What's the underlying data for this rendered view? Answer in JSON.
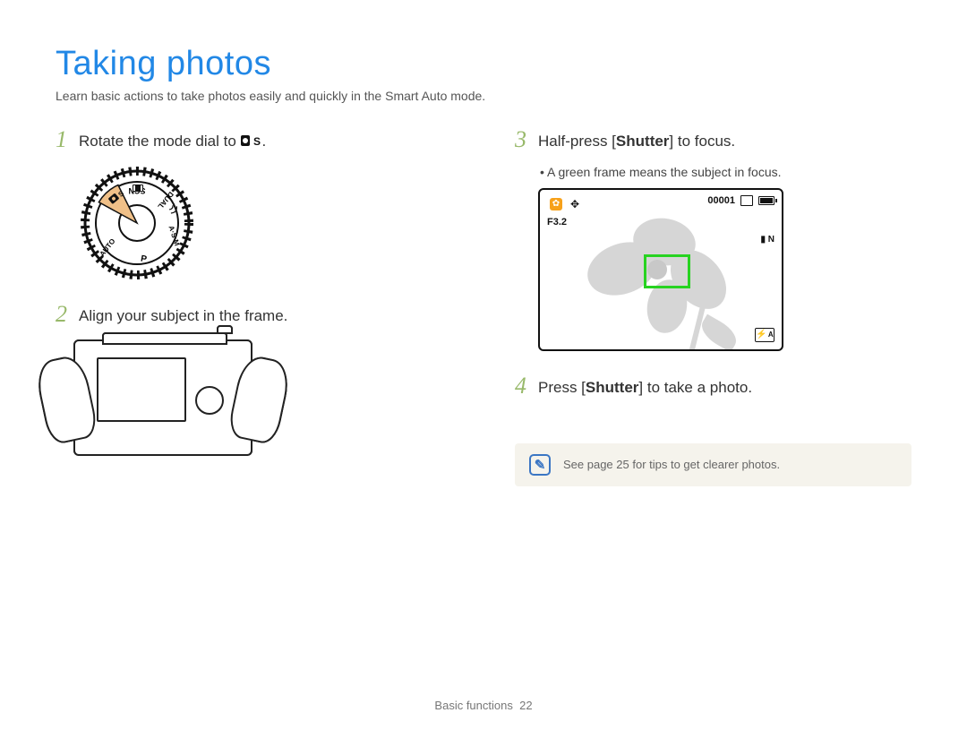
{
  "title": "Taking photos",
  "subtitle": "Learn basic actions to take photos easily and quickly in the Smart Auto mode.",
  "steps": {
    "n1": "1",
    "s1_pre": "Rotate the mode dial to ",
    "s1_icon_alt": "Smart Auto",
    "s1_post": ".",
    "n2": "2",
    "s2": "Align your subject in the frame.",
    "n3": "3",
    "s3_pre": "Half-press [",
    "s3_bold": "Shutter",
    "s3_post": "] to focus.",
    "s3_bullet": "A green frame means the subject in focus.",
    "n4": "4",
    "s4_pre": "Press [",
    "s4_bold": "Shutter",
    "s4_post": "] to take a photo."
  },
  "dial_modes": [
    "SCN",
    "DUAL",
    "A·S·M",
    "P",
    "AUTO"
  ],
  "lcd": {
    "aperture": "F3.2",
    "shots_remaining": "00001",
    "quality": "N",
    "flash_mode": "A"
  },
  "tip": "See page 25 for tips to get clearer photos.",
  "footer_section": "Basic functions",
  "footer_page": "22"
}
